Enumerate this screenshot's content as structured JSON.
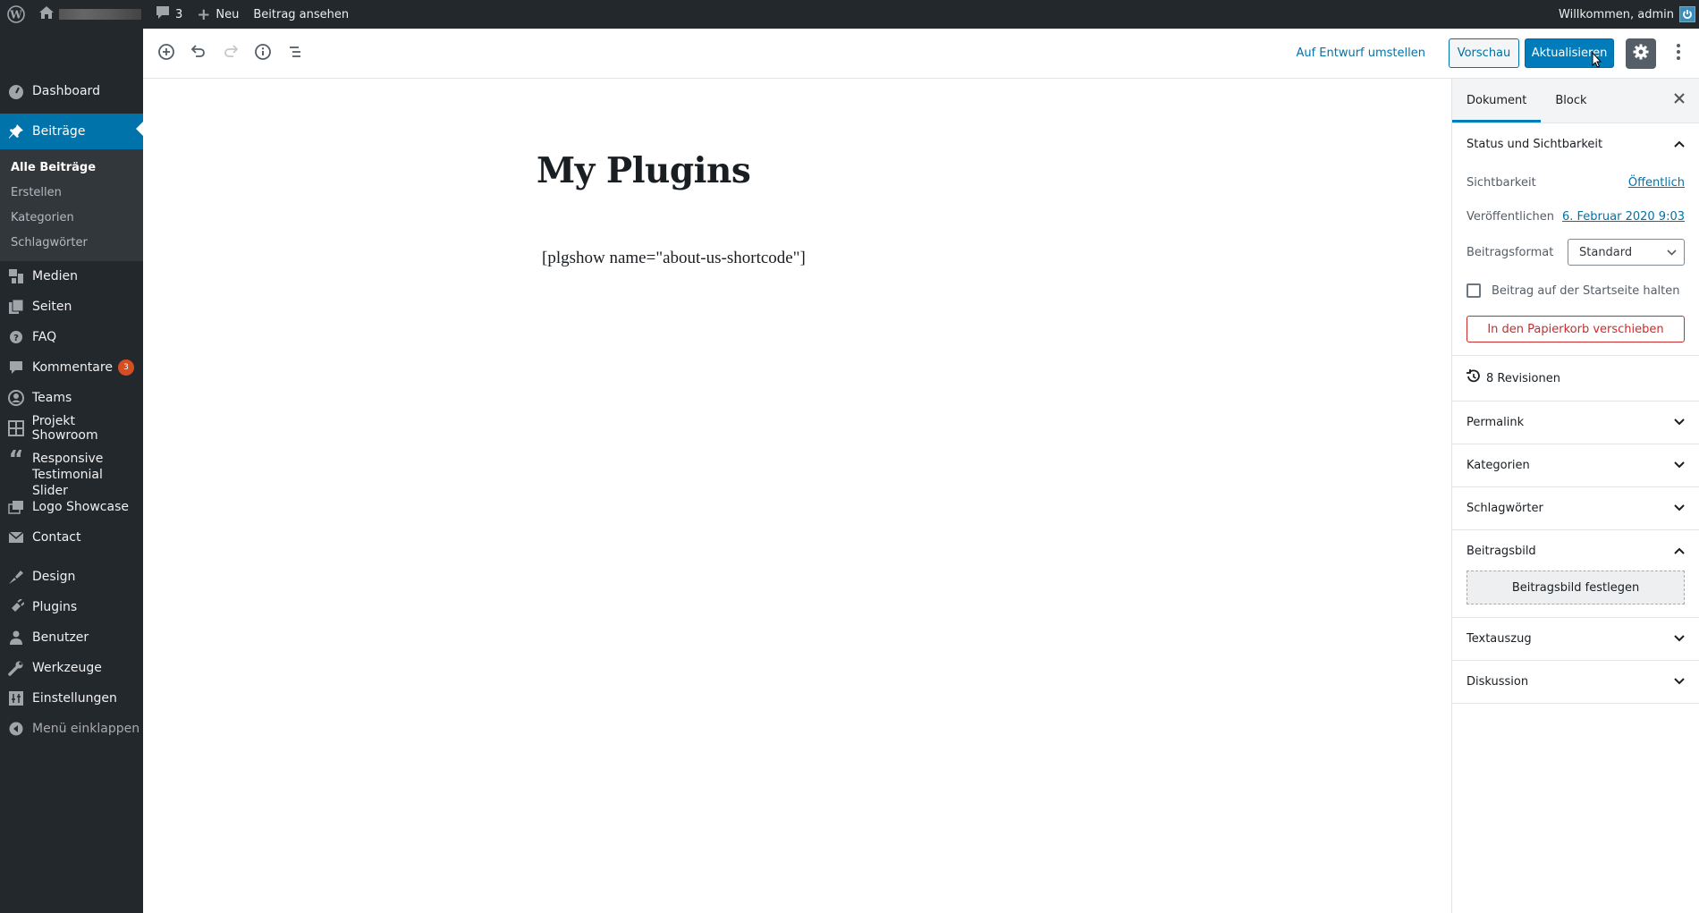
{
  "admin_bar": {
    "comments_count": "3",
    "new_label": "Neu",
    "view_post_label": "Beitrag ansehen",
    "welcome": "Willkommen, admin"
  },
  "sidebar": {
    "items": [
      {
        "label": "Dashboard",
        "icon": "dashboard-icon"
      },
      {
        "label": "Beiträge",
        "icon": "pin-icon",
        "active": true
      },
      {
        "label": "Medien",
        "icon": "media-icon"
      },
      {
        "label": "Seiten",
        "icon": "pages-icon"
      },
      {
        "label": "FAQ",
        "icon": "help-icon"
      },
      {
        "label": "Kommentare",
        "icon": "comment-icon",
        "badge": "3"
      },
      {
        "label": "Teams",
        "icon": "team-icon"
      },
      {
        "label": "Projekt Showroom",
        "icon": "grid-icon"
      },
      {
        "label": "Responsive Testimonial Slider",
        "icon": "quote-icon"
      },
      {
        "label": "Logo Showcase",
        "icon": "images-icon"
      },
      {
        "label": "Contact",
        "icon": "mail-icon"
      },
      {
        "label": "Design",
        "icon": "brush-icon"
      },
      {
        "label": "Plugins",
        "icon": "plugin-icon"
      },
      {
        "label": "Benutzer",
        "icon": "user-icon"
      },
      {
        "label": "Werkzeuge",
        "icon": "wrench-icon"
      },
      {
        "label": "Einstellungen",
        "icon": "settings-icon"
      }
    ],
    "submenu": [
      "Alle Beiträge",
      "Erstellen",
      "Kategorien",
      "Schlagwörter"
    ],
    "collapse_label": "Menü einklappen"
  },
  "toolbar": {
    "switch_to_draft": "Auf Entwurf umstellen",
    "preview": "Vorschau",
    "update": "Aktualisieren"
  },
  "post": {
    "title": "My Plugins",
    "content": "[plgshow name=\"about-us-shortcode\"]"
  },
  "settings": {
    "tabs": [
      "Dokument",
      "Block"
    ],
    "status_section": {
      "title": "Status und Sichtbarkeit",
      "visibility_label": "Sichtbarkeit",
      "visibility_value": "Öffentlich",
      "publish_label": "Veröffentlichen",
      "publish_value": "6. Februar 2020 9:03",
      "format_label": "Beitragsformat",
      "format_value": "Standard",
      "sticky_label": "Beitrag auf der Startseite halten",
      "sticky_checked": false,
      "trash_label": "In den Papierkorb verschieben"
    },
    "revisions": "8 Revisionen",
    "sections": {
      "permalink": "Permalink",
      "categories": "Kategorien",
      "tags": "Schlagwörter",
      "featured_image": "Beitragsbild",
      "featured_image_button": "Beitragsbild festlegen",
      "excerpt": "Textauszug",
      "discussion": "Diskussion"
    }
  },
  "colors": {
    "admin_dark": "#23282d",
    "accent": "#0073aa",
    "primary_button": "#007cba",
    "danger": "#c92c2c",
    "badge": "#d54e21"
  }
}
